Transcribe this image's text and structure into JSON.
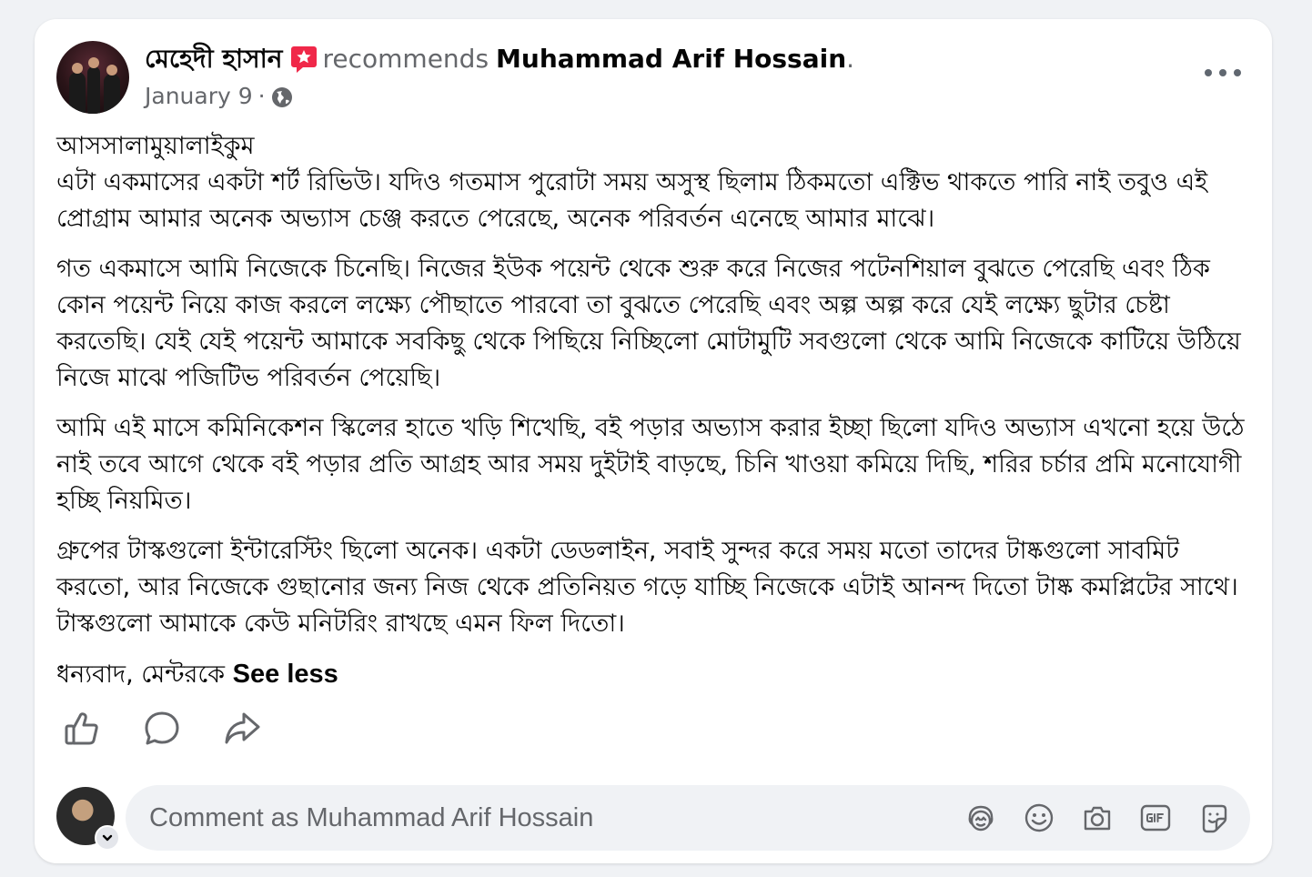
{
  "post": {
    "author": "মেহেদী হাসান",
    "recommends_text": "recommends",
    "page_name": "Muhammad Arif Hossain",
    "dot": ".",
    "date": "January 9",
    "separator": "·",
    "paragraphs": [
      "আসসালামুয়ালাইকুম\nএটা একমাসের একটা শর্ট রিভিউ। যদিও গতমাস পুরোটা সময় অসুস্থ ছিলাম ঠিকমতো এক্টিভ থাকতে পারি নাই তবুও এই প্রোগ্রাম আমার অনেক অভ্যাস চেঞ্জ করতে পেরেছে, অনেক পরিবর্তন এনেছে আমার মাঝে।",
      "গত একমাসে আমি নিজেকে চিনেছি। নিজের ইউক পয়েন্ট থেকে শুরু করে নিজের পটেনশিয়াল বুঝতে পেরেছি এবং ঠিক কোন পয়েন্ট নিয়ে কাজ করলে লক্ষ্যে পৌছাতে পারবো তা বুঝতে পেরেছি এবং অল্প অল্প করে যেই লক্ষ্যে ছুটার চেষ্টা করতেছি। যেই যেই পয়েন্ট আমাকে সবকিছু থেকে পিছিয়ে নিচ্ছিলো মোটামুটি সবগুলো থেকে আমি নিজেকে কাটিয়ে উঠিয়ে নিজে মাঝে পজিটিভ পরিবর্তন পেয়েছি।",
      "আমি এই মাসে কমিনিকেশন স্কিলের হাতে খড়ি শিখেছি, বই পড়ার অভ্যাস করার ইচ্ছা ছিলো যদিও অভ্যাস এখনো হয়ে উঠে নাই তবে আগে থেকে বই পড়ার প্রতি আগ্রহ আর সময় দুইটাই বাড়ছে, চিনি খাওয়া কমিয়ে দিছি, শরির চর্চার প্রমি মনোযোগী হচ্ছি নিয়মিত।",
      "গ্রুপের টাস্কগুলো  ইন্টারেস্টিং ছিলো অনেক। একটা ডেডলাইন, সবাই সুন্দর করে সময় মতো তাদের টাষ্কগুলো সাবমিট করতো, আর নিজেকে গুছানোর জন্য নিজ থেকে প্রতিনিয়ত গড়ে যাচ্ছি নিজেকে এটাই আনন্দ দিতো টাষ্ক কমপ্লিটের সাথে। টাস্কগুলো আমাকে কেউ মনিটরিং রাখছে এমন ফিল দিতো।"
    ],
    "closing": "ধন্যবাদ, মেন্টরকে",
    "see_less": "See less"
  },
  "comment": {
    "placeholder": "Comment as Muhammad Arif Hossain"
  },
  "icons": {
    "recommend": "recommend-star-icon",
    "privacy": "globe-icon",
    "more": "more-options-icon",
    "like": "like-icon",
    "comment": "comment-icon",
    "share": "share-icon",
    "avatar_sticker": "avatar-sticker-icon",
    "emoji": "emoji-icon",
    "camera": "camera-icon",
    "gif": "gif-icon",
    "sticker": "sticker-icon"
  },
  "colors": {
    "recommend": "#f02849",
    "secondary_text": "#65676b",
    "icon_gray": "#65676b"
  }
}
